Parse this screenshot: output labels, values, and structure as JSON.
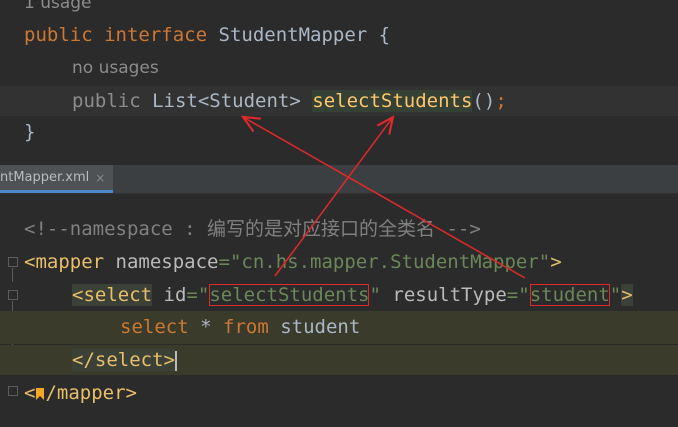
{
  "java": {
    "usage_top": "1 usage",
    "decl_kw1": "public",
    "decl_kw2": "interface",
    "decl_name": "StudentMapper",
    "decl_brace": "{",
    "usage_method": "no usages",
    "method_kw": "public",
    "method_type": "List<Student>",
    "method_name": "selectStudents",
    "method_parens": "()",
    "method_semi": ";",
    "close_brace": "}"
  },
  "tab": {
    "label": "ntMapper.xml",
    "close_glyph": "×"
  },
  "xml": {
    "comment": "<!--namespace : 编写的是对应接口的全类名 -->",
    "mapper_open": "<mapper",
    "ns_attr": "namespace",
    "ns_eq": "=",
    "ns_value": "\"cn.hs.mapper.StudentMapper\"",
    "mapper_gt": ">",
    "select_open": "<select",
    "id_attr": "id",
    "eq": "=",
    "quote": "\"",
    "id_value": "selectStudents",
    "rt_attr": "resultType",
    "rt_value": "student",
    "select_gt": ">",
    "sql_select": "select",
    "sql_star": "*",
    "sql_from": "from",
    "sql_table": "student",
    "select_close": "</select>",
    "mapper_close_lt": "<",
    "mapper_close_rest": "/mapper>"
  },
  "colors": {
    "annotation": "#e0292b",
    "background": "#2b2b2b",
    "keyword": "#cc7832",
    "tag": "#e8bf6a",
    "string": "#6a8759"
  }
}
